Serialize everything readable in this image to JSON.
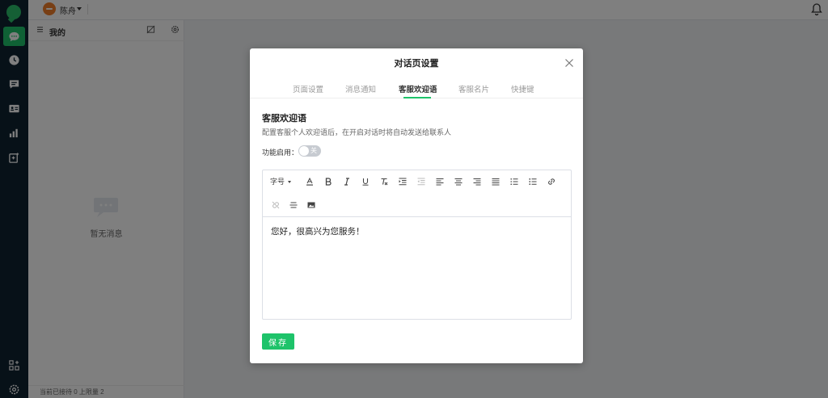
{
  "app": {
    "user_name": "陈舟"
  },
  "panel": {
    "title": "我的",
    "empty_text": "暂无消息",
    "footer": "当前已接待 0 上限量 2"
  },
  "modal": {
    "title": "对话页设置",
    "tabs": [
      {
        "label": "页面设置",
        "active": false
      },
      {
        "label": "消息通知",
        "active": false
      },
      {
        "label": "客服欢迎语",
        "active": true
      },
      {
        "label": "客服名片",
        "active": false
      },
      {
        "label": "快捷键",
        "active": false
      }
    ],
    "section_title": "客服欢迎语",
    "section_desc": "配置客服个人欢迎语后，在开启对话时将自动发送给联系人",
    "enable_label": "功能启用：",
    "toggle_text": "关",
    "toggle_on": false,
    "editor": {
      "font_size_label": "字号",
      "content": "您好，很高兴为您服务！"
    },
    "save_label": "保存"
  },
  "colors": {
    "accent": "#1ec36a",
    "rail": "#0e2231",
    "avatar": "#f07f2a"
  }
}
